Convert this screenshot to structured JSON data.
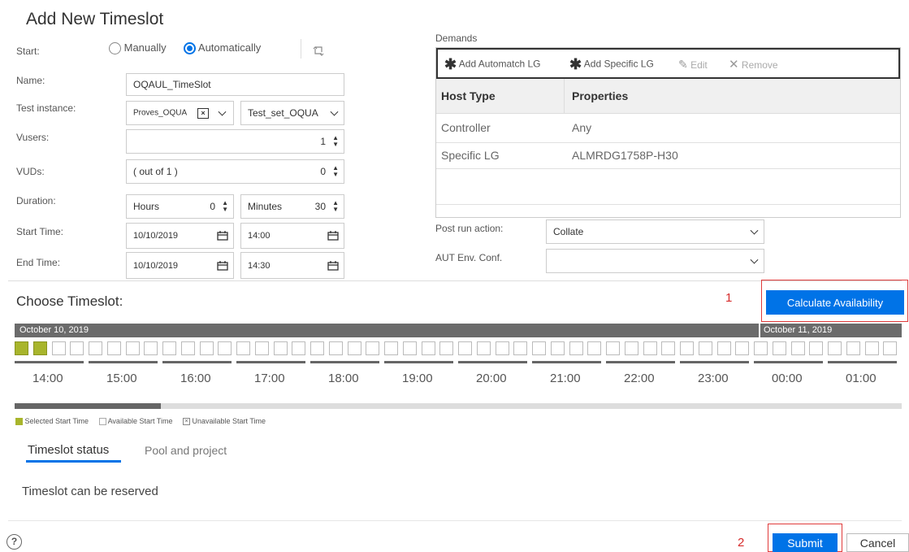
{
  "dialog": {
    "title": "Add New Timeslot"
  },
  "form": {
    "start_label": "Start:",
    "start_options": [
      "Manually",
      "Automatically"
    ],
    "start_selected": "Automatically",
    "name_label": "Name:",
    "name_value": "OQAUL_TimeSlot",
    "test_instance_label": "Test instance:",
    "test_instance_value": "Proves_OQUA",
    "test_set_value": "Test_set_OQUA",
    "vusers_label": "Vusers:",
    "vusers_value": "1",
    "vuds_label": "VUDs:",
    "vuds_hint": "( out of 1 )",
    "vuds_value": "0",
    "duration_label": "Duration:",
    "hours_label": "Hours",
    "hours_value": "0",
    "minutes_label": "Minutes",
    "minutes_value": "30",
    "start_time_label": "Start Time:",
    "start_date": "10/10/2019",
    "start_hour": "14:00",
    "end_time_label": "End Time:",
    "end_date": "10/10/2019",
    "end_hour": "14:30"
  },
  "demands": {
    "label": "Demands",
    "toolbar": {
      "add_automatch": "Add Automatch LG",
      "add_specific": "Add Specific LG",
      "edit": "Edit",
      "remove": "Remove"
    },
    "columns": [
      "Host Type",
      "Properties"
    ],
    "rows": [
      {
        "host_type": "Controller",
        "properties": "Any"
      },
      {
        "host_type": "Specific LG",
        "properties": "ALMRDG1758P-H30"
      }
    ],
    "post_run_label": "Post run action:",
    "post_run_value": "Collate",
    "aut_env_label": "AUT Env. Conf.",
    "aut_env_value": ""
  },
  "timeslot": {
    "heading": "Choose Timeslot:",
    "calculate_label": "Calculate Availability",
    "annotation_1": "1",
    "date_1": "October 10, 2019",
    "date_2": "October 11, 2019",
    "hours": [
      "14:00",
      "15:00",
      "16:00",
      "17:00",
      "18:00",
      "19:00",
      "20:00",
      "21:00",
      "22:00",
      "23:00",
      "00:00",
      "01:00"
    ],
    "legend": {
      "selected": "Selected Start Time",
      "available": "Available Start Time",
      "unavailable": "Unavailable Start Time"
    },
    "colors": {
      "selected": "#a8b52c",
      "header_bar": "#6b6b6b",
      "accent": "#0073e7"
    }
  },
  "status": {
    "tabs": [
      "Timeslot status",
      "Pool and project"
    ],
    "active_tab": "Timeslot status",
    "message": "Timeslot can be reserved"
  },
  "footer": {
    "help_icon": "help-icon",
    "annotation_2": "2",
    "submit_label": "Submit",
    "cancel_label": "Cancel"
  }
}
